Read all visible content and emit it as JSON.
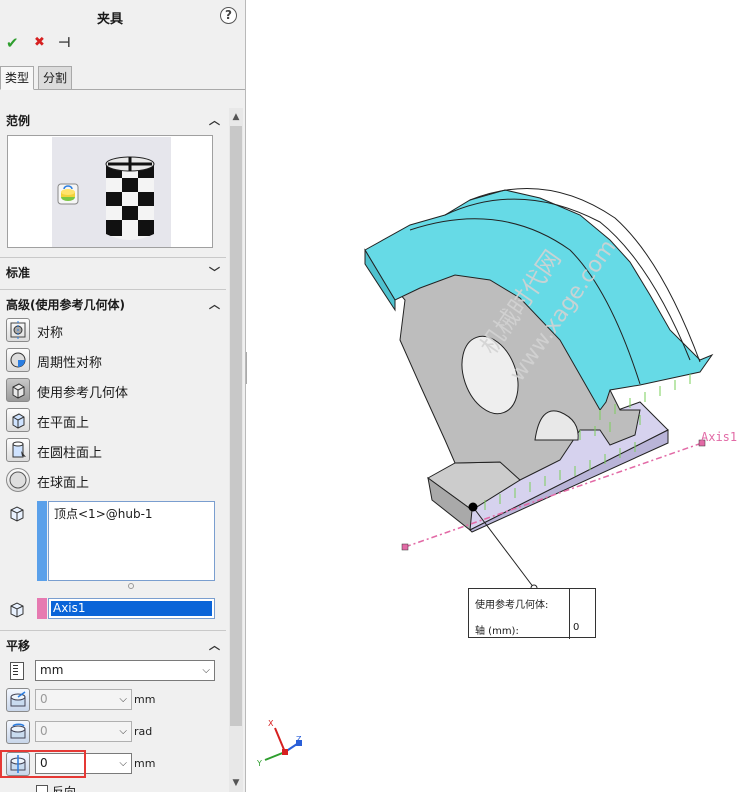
{
  "panel": {
    "title": "夹具",
    "help_label": "?",
    "accept_glyph": "✔",
    "cancel_glyph": "✖",
    "pin_glyph": "⊣",
    "tabs": [
      {
        "label": "类型"
      },
      {
        "label": "分割"
      }
    ]
  },
  "groups": {
    "example": {
      "label": "范例"
    },
    "standard": {
      "label": "标准"
    },
    "advanced": {
      "label": "高级(使用参考几何体)"
    },
    "translation": {
      "label": "平移"
    }
  },
  "options": [
    {
      "label": "对称"
    },
    {
      "label": "周期性对称"
    },
    {
      "label": "使用参考几何体"
    },
    {
      "label": "在平面上"
    },
    {
      "label": "在圆柱面上"
    },
    {
      "label": "在球面上"
    }
  ],
  "selection": {
    "vertex_item": "顶点<1>@hub-1",
    "axis_item": "Axis1"
  },
  "units": {
    "selected": "mm"
  },
  "fields": [
    {
      "value": "0",
      "unit": "mm"
    },
    {
      "value": "0",
      "unit": "rad"
    },
    {
      "value": "0",
      "unit": "mm"
    }
  ],
  "reverse_label": "反向",
  "viewport": {
    "callout_row1": "使用参考几何体:",
    "callout_row2_label": "轴 (mm):",
    "callout_row2_value": "0",
    "axis_label": "Axis1",
    "watermark_line1": "机械时代网",
    "watermark_line2": "www.xage.com",
    "triad": {
      "x": "X",
      "y": "Y",
      "z": "Z"
    }
  },
  "colors": {
    "part_cyan": "#66dae6",
    "part_gray": "#bebebe",
    "part_lilac": "#d6d2ee",
    "axis_pink": "#e26aa6",
    "selection_blue": "#0a64d8",
    "highlight_red": "#e53935"
  }
}
